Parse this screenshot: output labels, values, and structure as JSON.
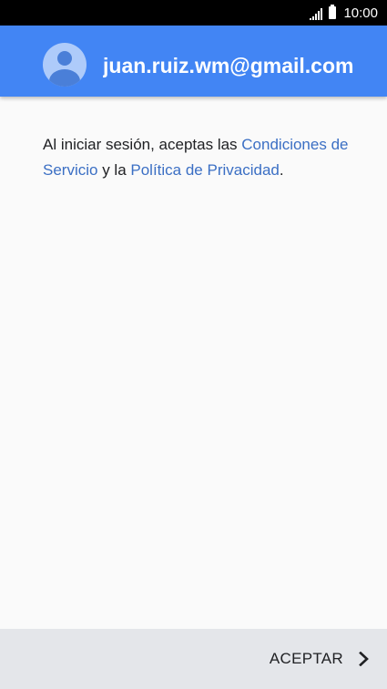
{
  "status_bar": {
    "time": "10:00",
    "signal_icon": "signal-bars-icon",
    "battery_icon": "battery-icon"
  },
  "header": {
    "avatar_icon": "account-avatar-icon",
    "email": "juan.ruiz.wm@gmail.com",
    "background_color": "#4285f4"
  },
  "terms": {
    "prefix": "Al iniciar sesión, aceptas las ",
    "terms_link": "Condiciones de Servicio",
    "middle": " y la ",
    "privacy_link": "Política de Privacidad",
    "suffix": ".",
    "link_color": "#3b6fc4"
  },
  "footer": {
    "accept_label": "ACEPTAR",
    "accept_icon": "chevron-right-icon"
  }
}
